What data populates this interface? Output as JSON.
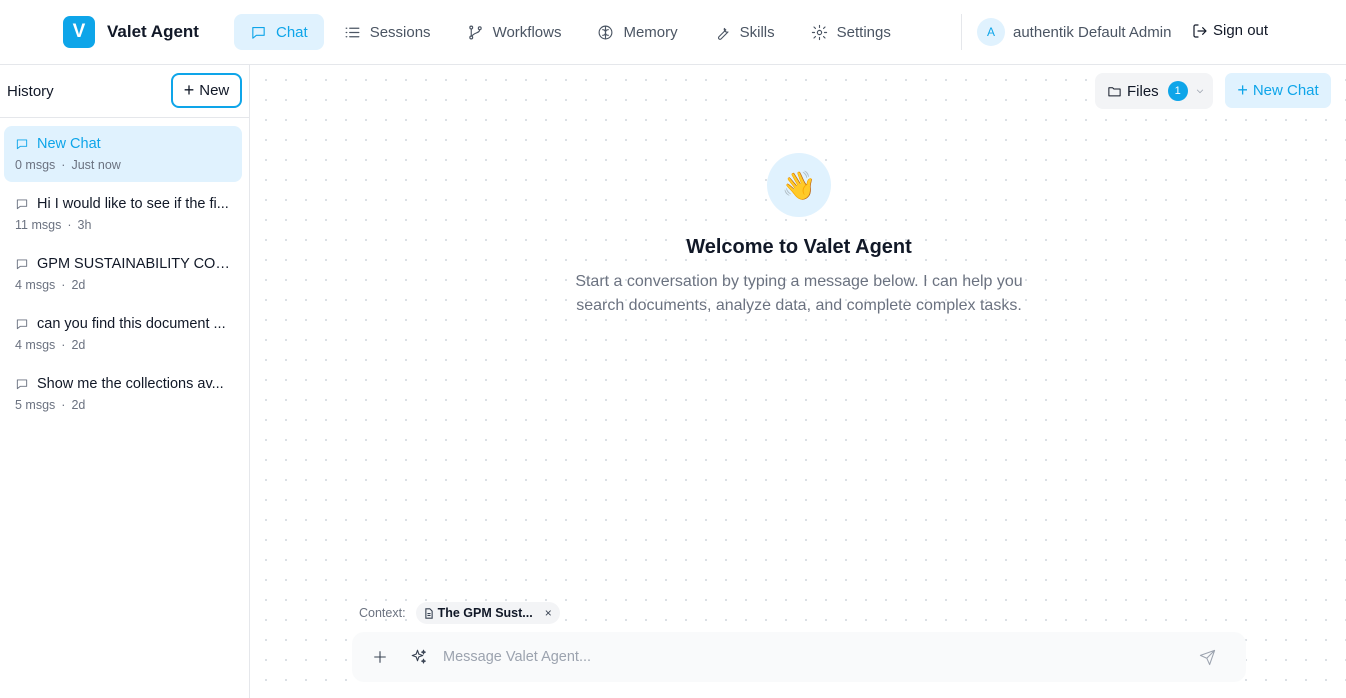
{
  "brand": {
    "logo_letter": "V",
    "name": "Valet Agent"
  },
  "nav": {
    "items": [
      {
        "label": "Chat",
        "icon": "chat-icon",
        "active": true
      },
      {
        "label": "Sessions",
        "icon": "list-icon"
      },
      {
        "label": "Workflows",
        "icon": "git-branch-icon"
      },
      {
        "label": "Memory",
        "icon": "brain-icon"
      },
      {
        "label": "Skills",
        "icon": "wrench-icon"
      },
      {
        "label": "Settings",
        "icon": "gear-icon"
      }
    ]
  },
  "user": {
    "avatar_letter": "A",
    "name": "authentik Default Admin",
    "signout_label": "Sign out"
  },
  "sidebar": {
    "title": "History",
    "new_label": "New",
    "sessions": [
      {
        "title": "New Chat",
        "msgs": "0 msgs",
        "time": "Just now",
        "active": true
      },
      {
        "title": "Hi I would like to see if the fi...",
        "msgs": "11 msgs",
        "time": "3h"
      },
      {
        "title": "GPM SUSTAINABILITY COM...",
        "msgs": "4 msgs",
        "time": "2d"
      },
      {
        "title": "can you find this document ...",
        "msgs": "4 msgs",
        "time": "2d"
      },
      {
        "title": "Show me the collections av...",
        "msgs": "5 msgs",
        "time": "2d"
      }
    ],
    "separator": "·"
  },
  "main": {
    "files_label": "Files",
    "files_count": "1",
    "new_chat_label": "New Chat",
    "welcome_emoji": "👋",
    "welcome_title": "Welcome to Valet Agent",
    "welcome_subtitle": "Start a conversation by typing a message below. I can help you search documents, analyze data, and complete complex tasks.",
    "context_label": "Context:",
    "context_chip": "The GPM Sust...",
    "context_close": "×",
    "composer_placeholder": "Message Valet Agent..."
  },
  "colors": {
    "accent": "#0ea5e9",
    "accent_bg": "#e0f2fe"
  }
}
